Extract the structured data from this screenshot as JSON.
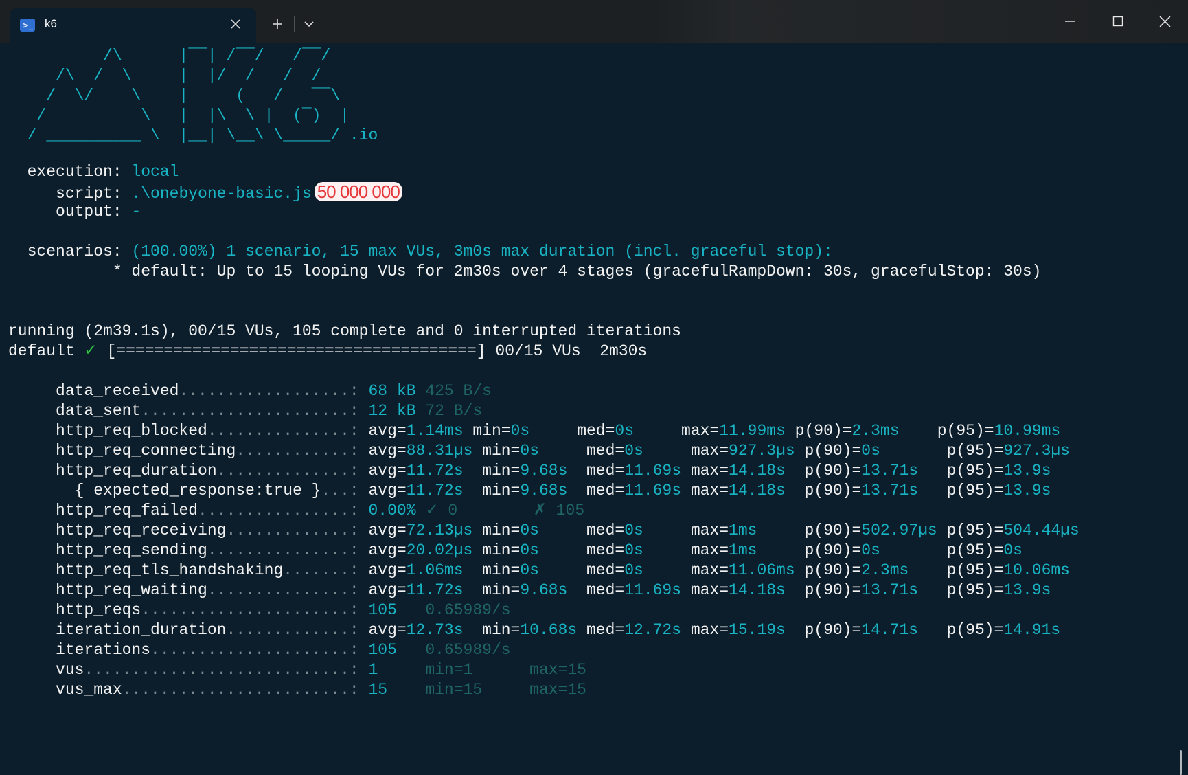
{
  "window": {
    "tab_title": "k6",
    "tab_icon": "powershell-icon",
    "controls": [
      "minimize-icon",
      "maximize-icon",
      "close-icon"
    ]
  },
  "colors": {
    "background": "#0c1e2b",
    "titlebar": "#1c2023",
    "cyan": "#19b4c4",
    "dim_cyan": "#1f6566",
    "text": "#f2f2f2",
    "check_green": "#2ec63f",
    "badge_red": "#e5383b"
  },
  "logo": {
    "lines": [
      "          /\\      |‾‾| /‾‾/   /‾‾/",
      "     /\\  /  \\     |  |/  /   /  /",
      "    /  \\/    \\    |     (   /   ‾‾\\",
      "   /          \\   |  |\\  \\ |  (‾)  |",
      "  / __________ \\  |__| \\__\\ \\_____/ .io"
    ]
  },
  "execution": {
    "execution_label": "  execution: ",
    "execution_value": "local",
    "script_label": "     script: ",
    "script_value": ".\\onebyone-basic.js",
    "script_badge": "50 000 000",
    "output_label": "     output: ",
    "output_value": "-"
  },
  "scenarios": {
    "label": "  scenarios: ",
    "summary": "(100.00%) 1 scenario, 15 max VUs, 3m0s max duration (incl. graceful stop):",
    "detail": "           * default: Up to 15 looping VUs for 2m30s over 4 stages (gracefulRampDown: 30s, gracefulStop: 30s)"
  },
  "progress": {
    "running": "running (2m39.1s), 00/15 VUs, 105 complete and 0 interrupted iterations",
    "default_prefix": "default ",
    "check": "✓",
    "bar": " [======================================] 00/15 VUs  2m30s"
  },
  "metrics": [
    {
      "name": "     data_received",
      "dots": "..................: ",
      "parts": [
        {
          "t": "68 kB",
          "c": "cyan"
        },
        {
          "t": " 425 B/s",
          "c": "dim"
        }
      ]
    },
    {
      "name": "     data_sent",
      "dots": "......................: ",
      "parts": [
        {
          "t": "12 kB",
          "c": "cyan"
        },
        {
          "t": " 72 B/s",
          "c": "dim"
        }
      ]
    },
    {
      "name": "     http_req_blocked",
      "dots": "...............: ",
      "parts": [
        {
          "t": "avg=",
          "c": "white"
        },
        {
          "t": "1.14ms ",
          "c": "cyan"
        },
        {
          "t": "min=",
          "c": "white"
        },
        {
          "t": "0s     ",
          "c": "cyan"
        },
        {
          "t": "med=",
          "c": "white"
        },
        {
          "t": "0s     ",
          "c": "cyan"
        },
        {
          "t": "max=",
          "c": "white"
        },
        {
          "t": "11.99ms ",
          "c": "cyan"
        },
        {
          "t": "p(90)=",
          "c": "white"
        },
        {
          "t": "2.3ms    ",
          "c": "cyan"
        },
        {
          "t": "p(95)=",
          "c": "white"
        },
        {
          "t": "10.99ms",
          "c": "cyan"
        }
      ]
    },
    {
      "name": "     http_req_connecting",
      "dots": "............: ",
      "parts": [
        {
          "t": "avg=",
          "c": "white"
        },
        {
          "t": "88.31µs ",
          "c": "cyan"
        },
        {
          "t": "min=",
          "c": "white"
        },
        {
          "t": "0s     ",
          "c": "cyan"
        },
        {
          "t": "med=",
          "c": "white"
        },
        {
          "t": "0s     ",
          "c": "cyan"
        },
        {
          "t": "max=",
          "c": "white"
        },
        {
          "t": "927.3µs ",
          "c": "cyan"
        },
        {
          "t": "p(90)=",
          "c": "white"
        },
        {
          "t": "0s       ",
          "c": "cyan"
        },
        {
          "t": "p(95)=",
          "c": "white"
        },
        {
          "t": "927.3µs",
          "c": "cyan"
        }
      ]
    },
    {
      "name": "     http_req_duration",
      "dots": "..............: ",
      "parts": [
        {
          "t": "avg=",
          "c": "white"
        },
        {
          "t": "11.72s  ",
          "c": "cyan"
        },
        {
          "t": "min=",
          "c": "white"
        },
        {
          "t": "9.68s  ",
          "c": "cyan"
        },
        {
          "t": "med=",
          "c": "white"
        },
        {
          "t": "11.69s ",
          "c": "cyan"
        },
        {
          "t": "max=",
          "c": "white"
        },
        {
          "t": "14.18s  ",
          "c": "cyan"
        },
        {
          "t": "p(90)=",
          "c": "white"
        },
        {
          "t": "13.71s   ",
          "c": "cyan"
        },
        {
          "t": "p(95)=",
          "c": "white"
        },
        {
          "t": "13.9s",
          "c": "cyan"
        }
      ]
    },
    {
      "name": "       { expected_response:true }",
      "dots": "...: ",
      "parts": [
        {
          "t": "avg=",
          "c": "white"
        },
        {
          "t": "11.72s  ",
          "c": "cyan"
        },
        {
          "t": "min=",
          "c": "white"
        },
        {
          "t": "9.68s  ",
          "c": "cyan"
        },
        {
          "t": "med=",
          "c": "white"
        },
        {
          "t": "11.69s ",
          "c": "cyan"
        },
        {
          "t": "max=",
          "c": "white"
        },
        {
          "t": "14.18s  ",
          "c": "cyan"
        },
        {
          "t": "p(90)=",
          "c": "white"
        },
        {
          "t": "13.71s   ",
          "c": "cyan"
        },
        {
          "t": "p(95)=",
          "c": "white"
        },
        {
          "t": "13.9s",
          "c": "cyan"
        }
      ]
    },
    {
      "name": "     http_req_failed",
      "dots": "................: ",
      "parts": [
        {
          "t": "0.00%",
          "c": "cyan"
        },
        {
          "t": " ✓ 0        ✗ 105",
          "c": "dim"
        }
      ]
    },
    {
      "name": "     http_req_receiving",
      "dots": ".............: ",
      "parts": [
        {
          "t": "avg=",
          "c": "white"
        },
        {
          "t": "72.13µs ",
          "c": "cyan"
        },
        {
          "t": "min=",
          "c": "white"
        },
        {
          "t": "0s     ",
          "c": "cyan"
        },
        {
          "t": "med=",
          "c": "white"
        },
        {
          "t": "0s     ",
          "c": "cyan"
        },
        {
          "t": "max=",
          "c": "white"
        },
        {
          "t": "1ms     ",
          "c": "cyan"
        },
        {
          "t": "p(90)=",
          "c": "white"
        },
        {
          "t": "502.97µs ",
          "c": "cyan"
        },
        {
          "t": "p(95)=",
          "c": "white"
        },
        {
          "t": "504.44µs",
          "c": "cyan"
        }
      ]
    },
    {
      "name": "     http_req_sending",
      "dots": "...............: ",
      "parts": [
        {
          "t": "avg=",
          "c": "white"
        },
        {
          "t": "20.02µs ",
          "c": "cyan"
        },
        {
          "t": "min=",
          "c": "white"
        },
        {
          "t": "0s     ",
          "c": "cyan"
        },
        {
          "t": "med=",
          "c": "white"
        },
        {
          "t": "0s     ",
          "c": "cyan"
        },
        {
          "t": "max=",
          "c": "white"
        },
        {
          "t": "1ms     ",
          "c": "cyan"
        },
        {
          "t": "p(90)=",
          "c": "white"
        },
        {
          "t": "0s       ",
          "c": "cyan"
        },
        {
          "t": "p(95)=",
          "c": "white"
        },
        {
          "t": "0s",
          "c": "cyan"
        }
      ]
    },
    {
      "name": "     http_req_tls_handshaking",
      "dots": ".......: ",
      "parts": [
        {
          "t": "avg=",
          "c": "white"
        },
        {
          "t": "1.06ms  ",
          "c": "cyan"
        },
        {
          "t": "min=",
          "c": "white"
        },
        {
          "t": "0s     ",
          "c": "cyan"
        },
        {
          "t": "med=",
          "c": "white"
        },
        {
          "t": "0s     ",
          "c": "cyan"
        },
        {
          "t": "max=",
          "c": "white"
        },
        {
          "t": "11.06ms ",
          "c": "cyan"
        },
        {
          "t": "p(90)=",
          "c": "white"
        },
        {
          "t": "2.3ms    ",
          "c": "cyan"
        },
        {
          "t": "p(95)=",
          "c": "white"
        },
        {
          "t": "10.06ms",
          "c": "cyan"
        }
      ]
    },
    {
      "name": "     http_req_waiting",
      "dots": "...............: ",
      "parts": [
        {
          "t": "avg=",
          "c": "white"
        },
        {
          "t": "11.72s  ",
          "c": "cyan"
        },
        {
          "t": "min=",
          "c": "white"
        },
        {
          "t": "9.68s  ",
          "c": "cyan"
        },
        {
          "t": "med=",
          "c": "white"
        },
        {
          "t": "11.69s ",
          "c": "cyan"
        },
        {
          "t": "max=",
          "c": "white"
        },
        {
          "t": "14.18s  ",
          "c": "cyan"
        },
        {
          "t": "p(90)=",
          "c": "white"
        },
        {
          "t": "13.71s   ",
          "c": "cyan"
        },
        {
          "t": "p(95)=",
          "c": "white"
        },
        {
          "t": "13.9s",
          "c": "cyan"
        }
      ]
    },
    {
      "name": "     http_reqs",
      "dots": "......................: ",
      "parts": [
        {
          "t": "105",
          "c": "cyan"
        },
        {
          "t": "   0.65989/s",
          "c": "dim"
        }
      ]
    },
    {
      "name": "     iteration_duration",
      "dots": ".............: ",
      "parts": [
        {
          "t": "avg=",
          "c": "white"
        },
        {
          "t": "12.73s  ",
          "c": "cyan"
        },
        {
          "t": "min=",
          "c": "white"
        },
        {
          "t": "10.68s ",
          "c": "cyan"
        },
        {
          "t": "med=",
          "c": "white"
        },
        {
          "t": "12.72s ",
          "c": "cyan"
        },
        {
          "t": "max=",
          "c": "white"
        },
        {
          "t": "15.19s  ",
          "c": "cyan"
        },
        {
          "t": "p(90)=",
          "c": "white"
        },
        {
          "t": "14.71s   ",
          "c": "cyan"
        },
        {
          "t": "p(95)=",
          "c": "white"
        },
        {
          "t": "14.91s",
          "c": "cyan"
        }
      ]
    },
    {
      "name": "     iterations",
      "dots": ".....................: ",
      "parts": [
        {
          "t": "105",
          "c": "cyan"
        },
        {
          "t": "   0.65989/s",
          "c": "dim"
        }
      ]
    },
    {
      "name": "     vus",
      "dots": "............................: ",
      "parts": [
        {
          "t": "1",
          "c": "cyan"
        },
        {
          "t": "     min=1      max=15",
          "c": "dim"
        }
      ]
    },
    {
      "name": "     vus_max",
      "dots": "........................: ",
      "parts": [
        {
          "t": "15",
          "c": "cyan"
        },
        {
          "t": "    min=15     max=15",
          "c": "dim"
        }
      ]
    }
  ]
}
